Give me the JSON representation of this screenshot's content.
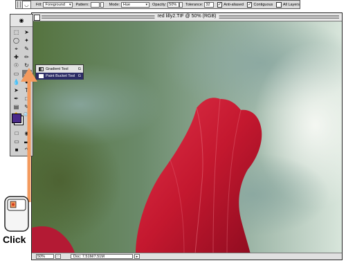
{
  "options_bar": {
    "fill_label": "Fill:",
    "fill_value": "Foreground",
    "pattern_label": "Pattern:",
    "mode_label": "Mode:",
    "mode_value": "Hue",
    "opacity_label": "Opacity:",
    "opacity_value": "50%",
    "tolerance_label": "Tolerance:",
    "tolerance_value": "32",
    "anti_aliased_label": "Anti-aliased",
    "anti_aliased_checked": true,
    "contiguous_label": "Contiguous",
    "contiguous_checked": true,
    "all_layers_label": "All Layers",
    "all_layers_checked": false
  },
  "toolbox": {
    "foreground_color": "#4a2a8a",
    "background_color": "#ffffff"
  },
  "flyout": {
    "items": [
      {
        "label": "Gradient Tool",
        "shortcut": "G",
        "selected": false
      },
      {
        "label": "Paint Bucket Tool",
        "shortcut": "G",
        "selected": true
      }
    ]
  },
  "document": {
    "title": "red lilly2.TIF @ 50% (RGB)",
    "zoom": "50%",
    "doc_size": "Doc: 7.51M/7.51M"
  },
  "callout": {
    "text": "Click",
    "arrow_color": "#f39a5e"
  }
}
